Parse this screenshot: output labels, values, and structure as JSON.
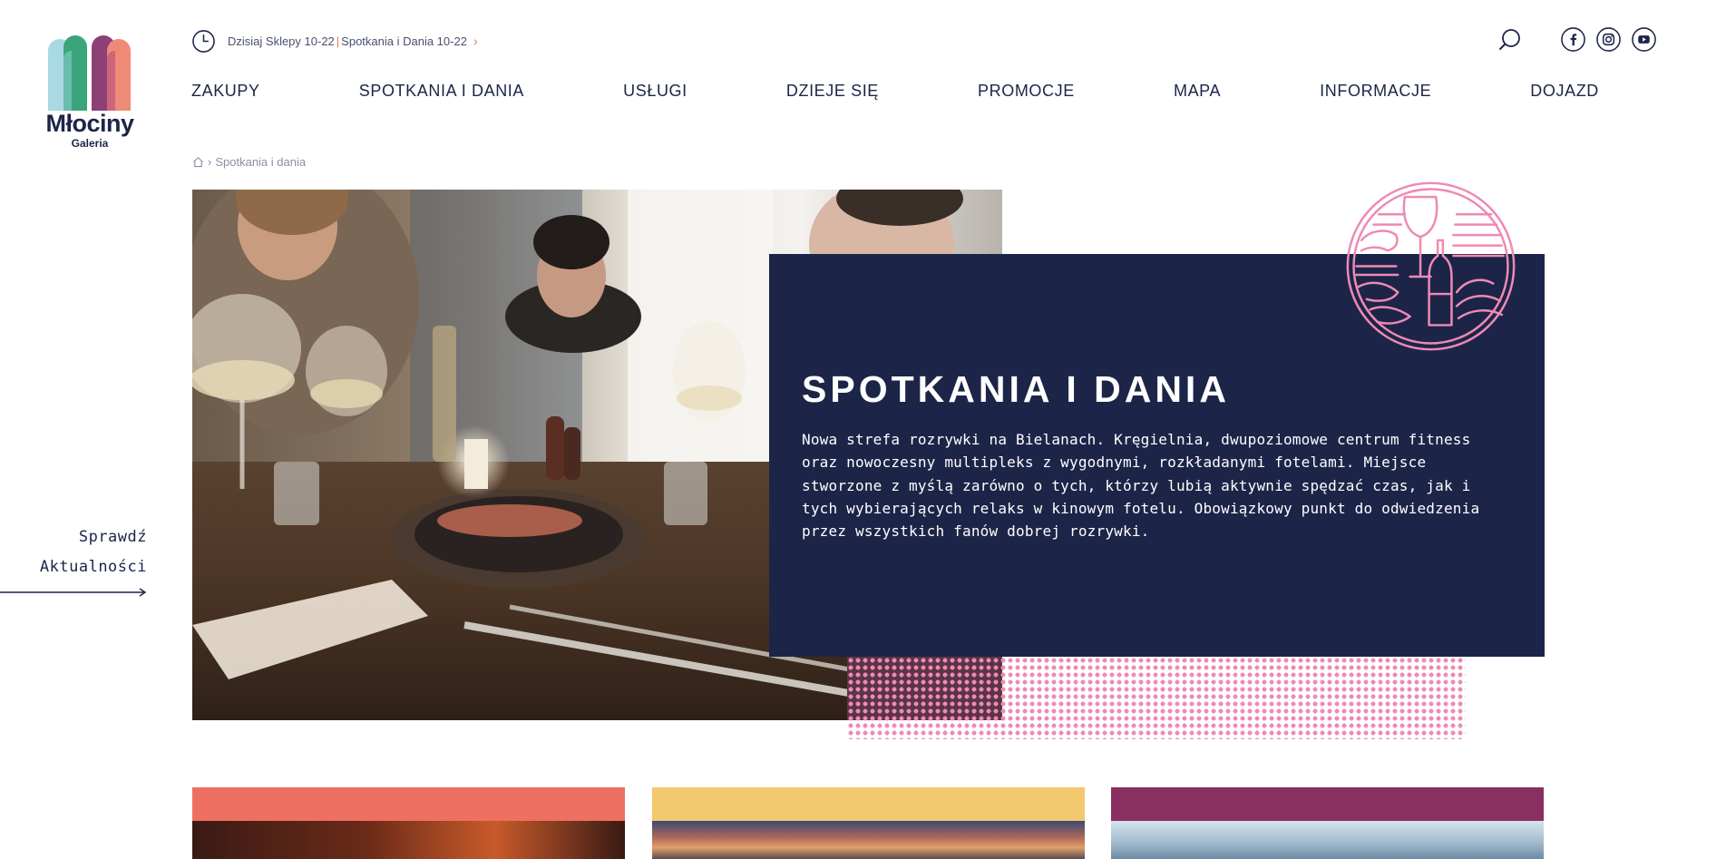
{
  "brand": {
    "name": "Młociny",
    "sub": "Galeria"
  },
  "topbar": {
    "hours_shops": "Dzisiaj Sklepy 10-22",
    "separator": "|",
    "hours_dining": "Spotkania i Dania 10-22",
    "arrow": "›",
    "icons": [
      "clock-icon",
      "search-icon",
      "facebook-icon",
      "instagram-icon",
      "youtube-icon"
    ]
  },
  "nav": {
    "items": [
      "ZAKUPY",
      "SPOTKANIA I DANIA",
      "USŁUGI",
      "DZIEJE SIĘ",
      "PROMOCJE",
      "MAPA",
      "INFORMACJE",
      "DOJAZD"
    ]
  },
  "breadcrumb": {
    "separator": "›",
    "current": "Spotkania i dania"
  },
  "side_link": {
    "line1": "Sprawdź",
    "line2": "Aktualności"
  },
  "hero": {
    "title": "SPOTKANIA I DANIA",
    "text": "Nowa strefa rozrywki na Bielanach. Kręgielnia, dwupoziomowe centrum fitness oraz nowoczesny multipleks z wygodnymi, rozkładanymi fotelami. Miejsce stworzone z myślą zarówno o tych, którzy lubią aktywnie spędzać czas, jak i tych wybierających relaks w kinowym fotelu. Obowiązkowy punkt do odwiedzenia przez wszystkich fanów dobrej rozrywki."
  },
  "colors": {
    "navy": "#1c2548",
    "coral": "#ee7060",
    "yellow": "#f2c96e",
    "plum": "#8a2f62",
    "pink": "#ee8ab4",
    "logo_cyan": "#a9d9e2",
    "logo_green": "#3aa57a",
    "logo_purple": "#8e3f76",
    "logo_salmon": "#ef8a77"
  }
}
